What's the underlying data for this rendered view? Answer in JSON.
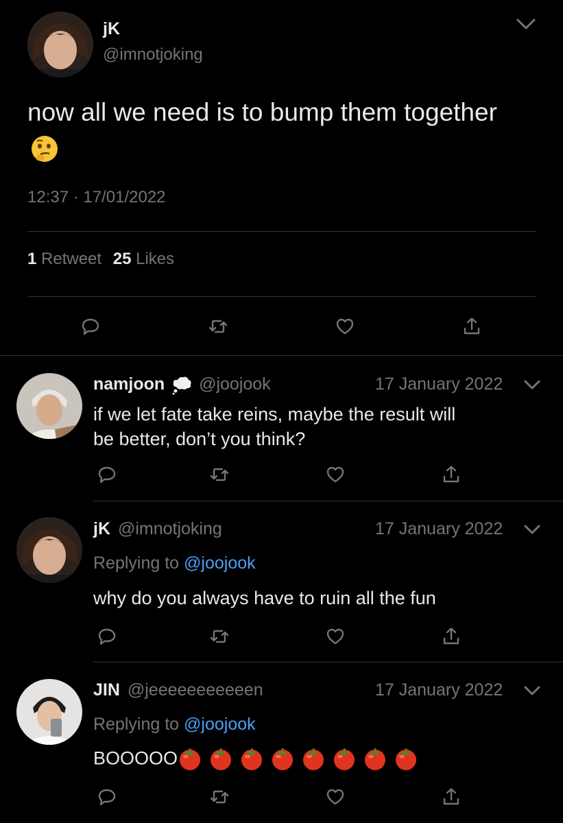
{
  "main_tweet": {
    "display_name": "jK",
    "handle": "@imnotjoking",
    "text": "now all we need is to bump them together",
    "emoji": "thinking-face",
    "time": "12:37",
    "dot": "·",
    "date": "17/01/2022",
    "retweet_count": "1",
    "retweet_label": "Retweet",
    "likes_count": "25",
    "likes_label": "Likes"
  },
  "replies": [
    {
      "display_name": "namjoon",
      "badge": "thought-balloon",
      "handle": "@joojook",
      "date": "17 January 2022",
      "text_line1": "if we let fate take reins, maybe the result will",
      "text_line2": "be better, don’t you think?"
    },
    {
      "display_name": "jK",
      "handle": "@imnotjoking",
      "date": "17 January 2022",
      "replying_prefix": "Replying to",
      "replying_to": "@joojook",
      "text": "why do you always have to ruin all the fun"
    },
    {
      "display_name": "JIN",
      "handle": "@jeeeeeeeeeeen",
      "date": "17 January 2022",
      "replying_prefix": "Replying to",
      "replying_to": "@joojook",
      "text": "BOOOOO",
      "tomato_count": 8
    }
  ],
  "colors": {
    "background": "#000000",
    "text": "#e7e9ea",
    "muted": "#71767b",
    "link": "#4a9ff5",
    "divider": "#2f3336"
  },
  "icons": [
    "chevron-down-icon",
    "reply-icon",
    "retweet-icon",
    "like-icon",
    "share-icon",
    "tomato-icon"
  ]
}
